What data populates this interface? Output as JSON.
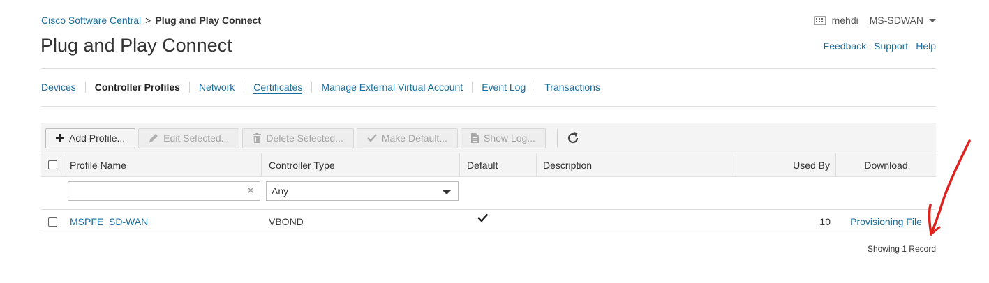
{
  "breadcrumb": {
    "parent": "Cisco Software Central",
    "separator": ">",
    "current": "Plug and Play Connect"
  },
  "page_title": "Plug and Play Connect",
  "user": {
    "name": "mehdi",
    "account": "MS-SDWAN"
  },
  "help_links": {
    "feedback": "Feedback",
    "support": "Support",
    "help": "Help"
  },
  "tabs": [
    {
      "label": "Devices"
    },
    {
      "label": "Controller Profiles"
    },
    {
      "label": "Network"
    },
    {
      "label": "Certificates"
    },
    {
      "label": "Manage External Virtual Account"
    },
    {
      "label": "Event Log"
    },
    {
      "label": "Transactions"
    }
  ],
  "toolbar": {
    "add": "Add Profile...",
    "edit": "Edit Selected...",
    "delete": "Delete Selected...",
    "make_default": "Make Default...",
    "show_log": "Show Log..."
  },
  "table": {
    "headers": {
      "profile_name": "Profile Name",
      "controller_type": "Controller Type",
      "default": "Default",
      "description": "Description",
      "used_by": "Used By",
      "download": "Download"
    },
    "filters": {
      "profile_name": "",
      "controller_type": "Any"
    },
    "rows": [
      {
        "profile_name": "MSPFE_SD-WAN",
        "controller_type": "VBOND",
        "default": true,
        "description": "",
        "used_by": "10",
        "download": "Provisioning File"
      }
    ]
  },
  "footer": {
    "record_count": "Showing 1 Record"
  },
  "colors": {
    "link": "#1a6c9c",
    "annotation": "#e0201c"
  }
}
